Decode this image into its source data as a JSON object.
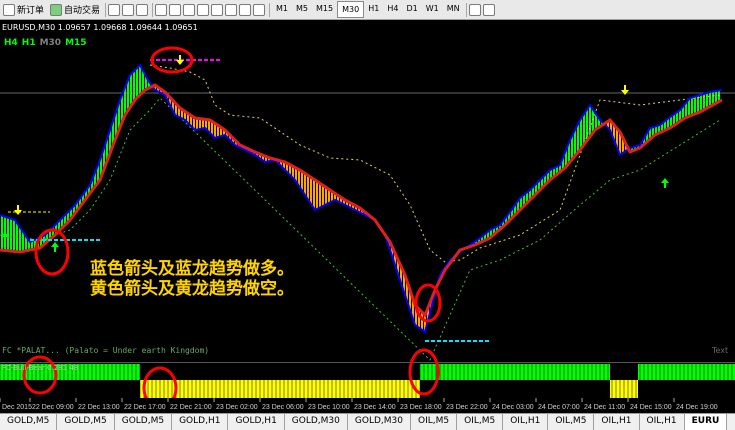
{
  "toolbar": {
    "new_order_label": "新订单",
    "auto_trade_label": "自动交易",
    "timeframes": [
      "M1",
      "M5",
      "M15",
      "M30",
      "H1",
      "H4",
      "D1",
      "W1",
      "MN"
    ],
    "active_timeframe": "M30"
  },
  "chart": {
    "symbol_info": "EURUSD,M30  1.09657 1.09668 1.09644 1.09651",
    "tf_labels": [
      {
        "text": "H4",
        "color": "#00ff00"
      },
      {
        "text": "H1",
        "color": "#00ff00"
      },
      {
        "text": "M30",
        "color": "#808080"
      },
      {
        "text": "M15",
        "color": "#00ff00"
      }
    ],
    "annotation_line1": "蓝色箭头及蓝龙趋势做多。",
    "annotation_line2": "黄色箭头及黄龙趋势做空。",
    "indicator_name": "FC *PALAT...  (Palato = Under earth Kingdom)",
    "indicator2_name": "FC-Bull-Bear 0.281 48",
    "text_marker": "Text",
    "time_labels": [
      "Dec 2015",
      "22 Dec 09:00",
      "22 Dec 13:00",
      "22 Dec 17:00",
      "22 Dec 21:00",
      "23 Dec 02:00",
      "23 Dec 06:00",
      "23 Dec 10:00",
      "23 Dec 14:00",
      "23 Dec 18:00",
      "23 Dec 22:00",
      "24 Dec 03:00",
      "24 Dec 07:00",
      "24 Dec 11:00",
      "24 Dec 15:00",
      "24 Dec 19:00"
    ]
  },
  "tabs": [
    "GOLD,M5",
    "GOLD,M5",
    "GOLD,M5",
    "GOLD,H1",
    "GOLD,H1",
    "GOLD,M30",
    "GOLD,M30",
    "OIL,M5",
    "OIL,M5",
    "OIL,H1",
    "OIL,M5",
    "OIL,H1",
    "OIL,H1",
    "EURU"
  ],
  "active_tab_index": 13,
  "colors": {
    "bull": "#00ff00",
    "bear": "#ffa500",
    "price": "#0000ff",
    "dragon": "#e02020",
    "signal": "#ffff00",
    "highlight": "#ff0000",
    "cyan_level": "#00e5ff",
    "magenta_level": "#ff00ff",
    "annotation": "#ffd400"
  }
}
